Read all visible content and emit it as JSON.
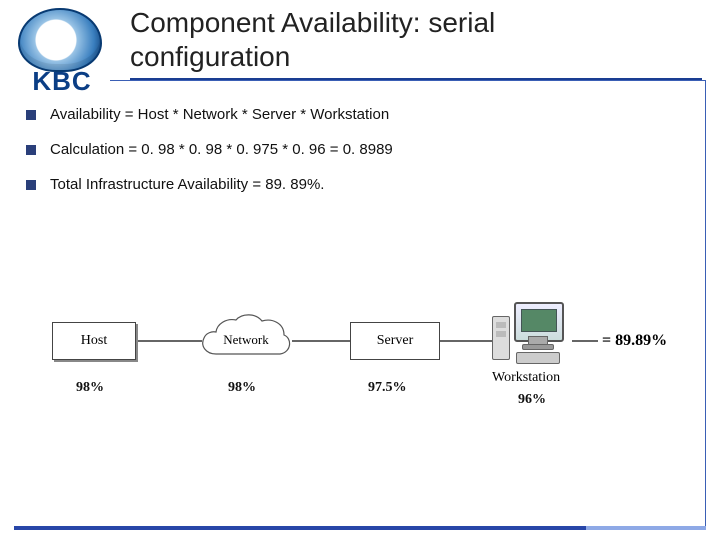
{
  "brand": {
    "wordmark": "KBC"
  },
  "title": {
    "line1": "Component Availability: serial",
    "line2": "configuration"
  },
  "bullets": [
    "Availability = Host * Network * Server * Workstation",
    "Calculation = 0. 98 * 0. 98 * 0. 975 * 0. 96 = 0. 8989",
    "Total Infrastructure Availability = 89. 89%."
  ],
  "diagram": {
    "components": [
      {
        "name": "Host",
        "percent": "98%"
      },
      {
        "name": "Network",
        "percent": "98%"
      },
      {
        "name": "Server",
        "percent": "97.5%"
      },
      {
        "name": "Workstation",
        "percent": "96%"
      }
    ],
    "result": "= 89.89%"
  }
}
